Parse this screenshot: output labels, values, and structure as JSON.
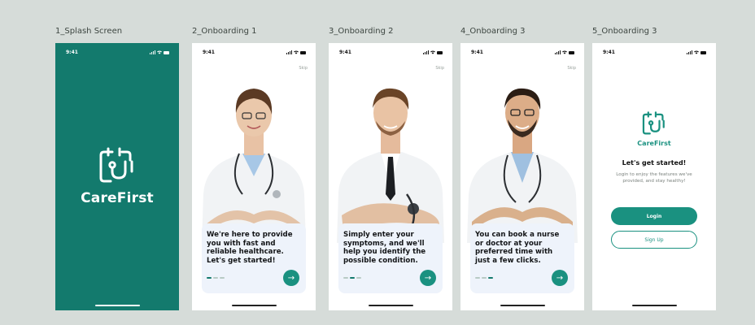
{
  "frames": [
    {
      "label": "1_Splash Screen"
    },
    {
      "label": "2_Onboarding 1"
    },
    {
      "label": "3_Onboarding 2"
    },
    {
      "label": "4_Onboarding 3"
    },
    {
      "label": "5_Onboarding 3"
    }
  ],
  "status_time": "9:41",
  "skip_label": "Skip",
  "brand_name": "CareFirst",
  "onboarding": [
    {
      "text": "We're here to provide you with fast and reliable healthcare. Let's get started!",
      "active_dot": 0
    },
    {
      "text": "Simply enter your symptoms, and we'll help you identify the possible condition.",
      "active_dot": 1
    },
    {
      "text": "You can book a nurse or doctor at your preferred time with just a few clicks.",
      "active_dot": 2
    }
  ],
  "arrow_icon": "arrow-right-icon",
  "login": {
    "title": "Let's get started!",
    "subtitle": "Login to enjoy the features we've provided, and stay healthy!",
    "login_button": "Login",
    "signup_button": "Sign Up"
  },
  "colors": {
    "brand": "#137a6d",
    "accent": "#1a9180",
    "background": "#d6dcd9",
    "card": "#eef3fb"
  }
}
